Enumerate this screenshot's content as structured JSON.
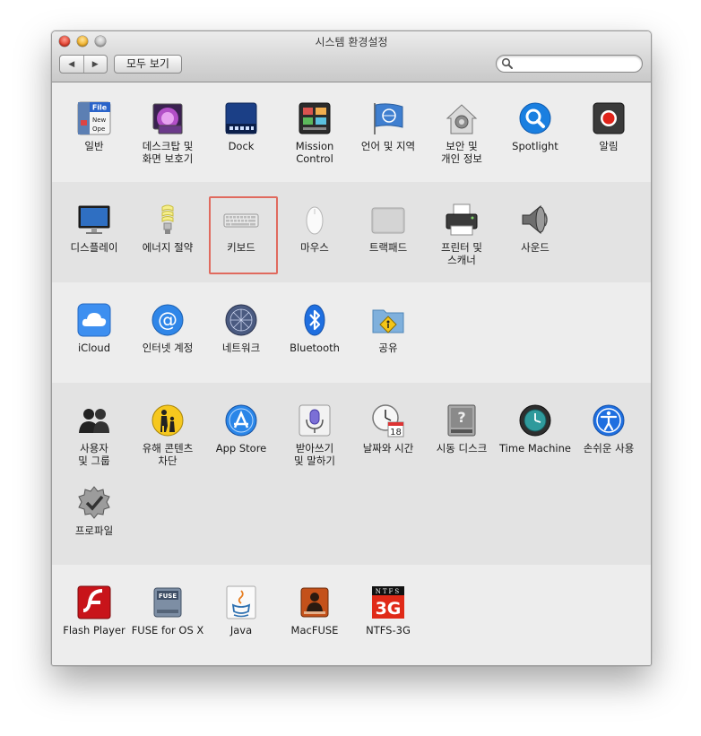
{
  "window": {
    "title": "시스템 환경설정"
  },
  "toolbar": {
    "back_glyph": "◀",
    "forward_glyph": "▶",
    "show_all_label": "모두 보기",
    "search_placeholder": "",
    "search_value": ""
  },
  "sections": {
    "personal": {
      "general": "일반",
      "desktop": "데스크탑 및\n화면 보호기",
      "dock": "Dock",
      "mission": "Mission\nControl",
      "language": "언어 및 지역",
      "security": "보안 및\n개인 정보",
      "spotlight": "Spotlight",
      "notifications": "알림"
    },
    "hardware": {
      "displays": "디스플레이",
      "energy": "에너지 절약",
      "keyboard": "키보드",
      "mouse": "마우스",
      "trackpad": "트랙패드",
      "printers": "프린터 및\n스캐너",
      "sound": "사운드"
    },
    "internet": {
      "icloud": "iCloud",
      "accounts": "인터넷 계정",
      "network": "네트워크",
      "bluetooth": "Bluetooth",
      "sharing": "공유"
    },
    "system": {
      "users": "사용자\n및 그룹",
      "parental": "유해 콘텐츠\n차단",
      "appstore": "App Store",
      "dictation": "받아쓰기\n및 말하기",
      "datetime": "날짜와 시간",
      "datetime_day": "18",
      "startup": "시동 디스크",
      "timemachine": "Time Machine",
      "accessibility": "손쉬운 사용",
      "profiles": "프로파일"
    },
    "other": {
      "flash": "Flash Player",
      "fuse": "FUSE for OS X",
      "fuse_badge": "FUSE",
      "java": "Java",
      "macfuse": "MacFUSE",
      "ntfs": "NTFS-3G",
      "ntfs_badge_top": "NTFS",
      "ntfs_badge_main": "3G"
    }
  },
  "general_icon_text": {
    "line1": "File",
    "line2": "New",
    "line3": "Ope"
  },
  "colors": {
    "highlight": "#e06a5e",
    "accent_blue": "#1a6fd6"
  }
}
